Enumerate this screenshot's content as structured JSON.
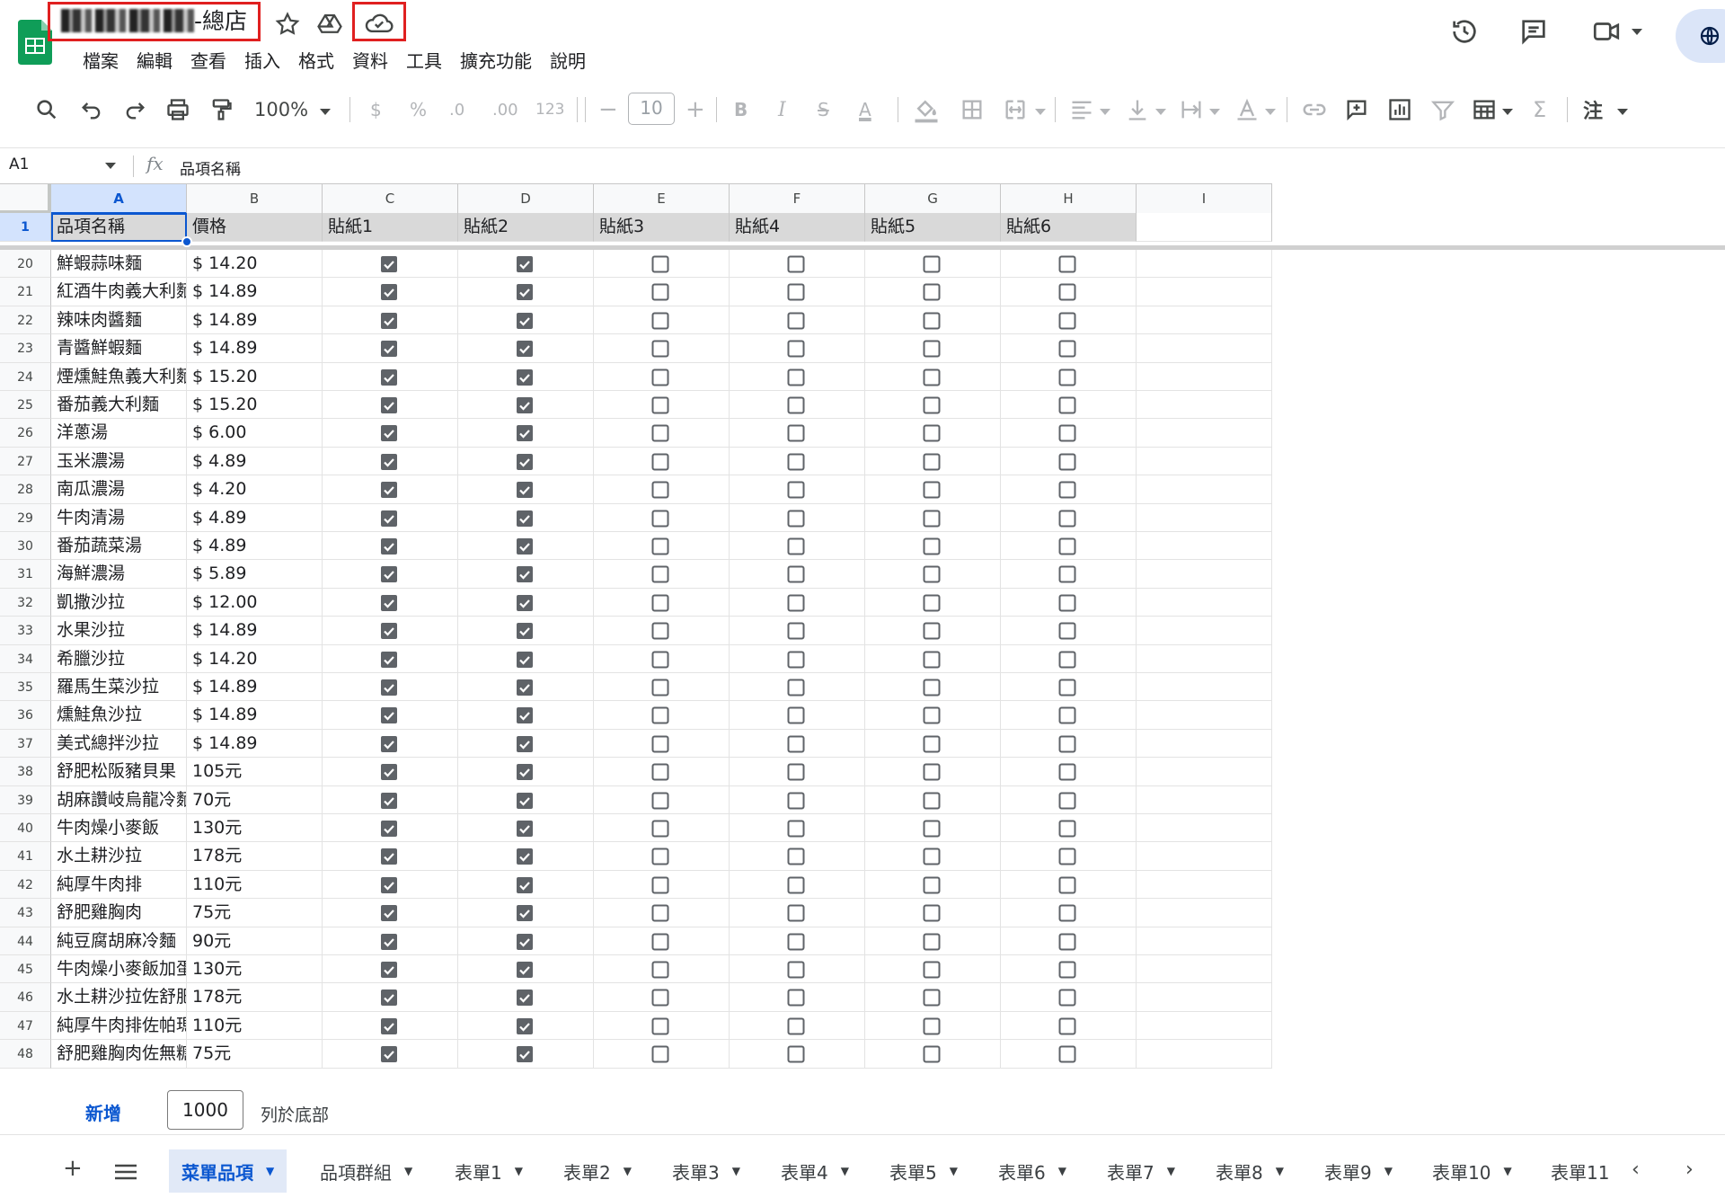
{
  "title": {
    "suffix": "-總店"
  },
  "menu": [
    "檔案",
    "編輯",
    "查看",
    "插入",
    "格式",
    "資料",
    "工具",
    "擴充功能",
    "說明"
  ],
  "toolbar": {
    "zoom": "100%",
    "currency": "$",
    "percent": "%",
    "dec_less": ".0",
    "dec_more": ".00",
    "number_format": "123",
    "font_size": "10",
    "bold": "B",
    "italic": "I",
    "strike": "S",
    "text_color": "A",
    "font_family_short": "注"
  },
  "formula_bar": {
    "cell_ref": "A1",
    "fx": "fx",
    "value": "品項名稱"
  },
  "columns": [
    "A",
    "B",
    "C",
    "D",
    "E",
    "F",
    "G",
    "H",
    "I"
  ],
  "header_row": {
    "number": "1",
    "cells": [
      "品項名稱",
      "價格",
      "貼紙1",
      "貼紙2",
      "貼紙3",
      "貼紙4",
      "貼紙5",
      "貼紙6",
      ""
    ]
  },
  "rows": [
    {
      "n": "20",
      "name": "鮮蝦蒜味麵",
      "price": "$ 14.20"
    },
    {
      "n": "21",
      "name": "紅酒牛肉義大利麵",
      "price": "$ 14.89"
    },
    {
      "n": "22",
      "name": "辣味肉醬麵",
      "price": "$ 14.89"
    },
    {
      "n": "23",
      "name": "青醬鮮蝦麵",
      "price": "$ 14.89"
    },
    {
      "n": "24",
      "name": "煙燻鮭魚義大利麵",
      "price": "$ 15.20"
    },
    {
      "n": "25",
      "name": "番茄義大利麵",
      "price": "$ 15.20"
    },
    {
      "n": "26",
      "name": "洋蔥湯",
      "price": "$ 6.00"
    },
    {
      "n": "27",
      "name": "玉米濃湯",
      "price": "$ 4.89"
    },
    {
      "n": "28",
      "name": "南瓜濃湯",
      "price": "$ 4.20"
    },
    {
      "n": "29",
      "name": "牛肉清湯",
      "price": "$ 4.89"
    },
    {
      "n": "30",
      "name": "番茄蔬菜湯",
      "price": "$ 4.89"
    },
    {
      "n": "31",
      "name": "海鮮濃湯",
      "price": "$ 5.89"
    },
    {
      "n": "32",
      "name": "凱撒沙拉",
      "price": "$ 12.00"
    },
    {
      "n": "33",
      "name": "水果沙拉",
      "price": "$ 14.89"
    },
    {
      "n": "34",
      "name": "希臘沙拉",
      "price": "$ 14.20"
    },
    {
      "n": "35",
      "name": "羅馬生菜沙拉",
      "price": "$ 14.89"
    },
    {
      "n": "36",
      "name": "燻鮭魚沙拉",
      "price": "$ 14.89"
    },
    {
      "n": "37",
      "name": "美式總拌沙拉",
      "price": "$ 14.89"
    },
    {
      "n": "38",
      "name": "舒肥松阪豬貝果",
      "price": "105元"
    },
    {
      "n": "39",
      "name": "胡麻讚岐烏龍冷麵",
      "price": "70元"
    },
    {
      "n": "40",
      "name": "牛肉燥小麥飯",
      "price": "130元"
    },
    {
      "n": "41",
      "name": "水土耕沙拉",
      "price": "178元"
    },
    {
      "n": "42",
      "name": "純厚牛肉排",
      "price": "110元"
    },
    {
      "n": "43",
      "name": "舒肥雞胸肉",
      "price": "75元"
    },
    {
      "n": "44",
      "name": "純豆腐胡麻冷麵",
      "price": "90元"
    },
    {
      "n": "45",
      "name": "牛肉燥小麥飯加蛋",
      "price": "130元"
    },
    {
      "n": "46",
      "name": "水土耕沙拉佐舒肥",
      "price": "178元"
    },
    {
      "n": "47",
      "name": "純厚牛肉排佐帕瑪",
      "price": "110元"
    },
    {
      "n": "48",
      "name": "舒肥雞胸肉佐無糖",
      "price": "75元"
    }
  ],
  "checkbox_pattern": {
    "sticker1": true,
    "sticker2": true,
    "sticker3": false,
    "sticker4": false,
    "sticker5": false,
    "sticker6": false
  },
  "add_rows": {
    "button": "新增",
    "count": "1000",
    "suffix": "列於底部"
  },
  "sheet_tabs": [
    "菜單品項",
    "品項群組",
    "表單1",
    "表單2",
    "表單3",
    "表單4",
    "表單5",
    "表單6",
    "表單7",
    "表單8",
    "表單9",
    "表單10",
    "表單11"
  ],
  "active_tab": 0,
  "colors": {
    "accent": "#0b57d0",
    "header_fill": "#d9d9d9",
    "selection_fill": "#d3e3fd",
    "highlight_red": "#e02020",
    "sheets_green": "#0f9d58"
  }
}
